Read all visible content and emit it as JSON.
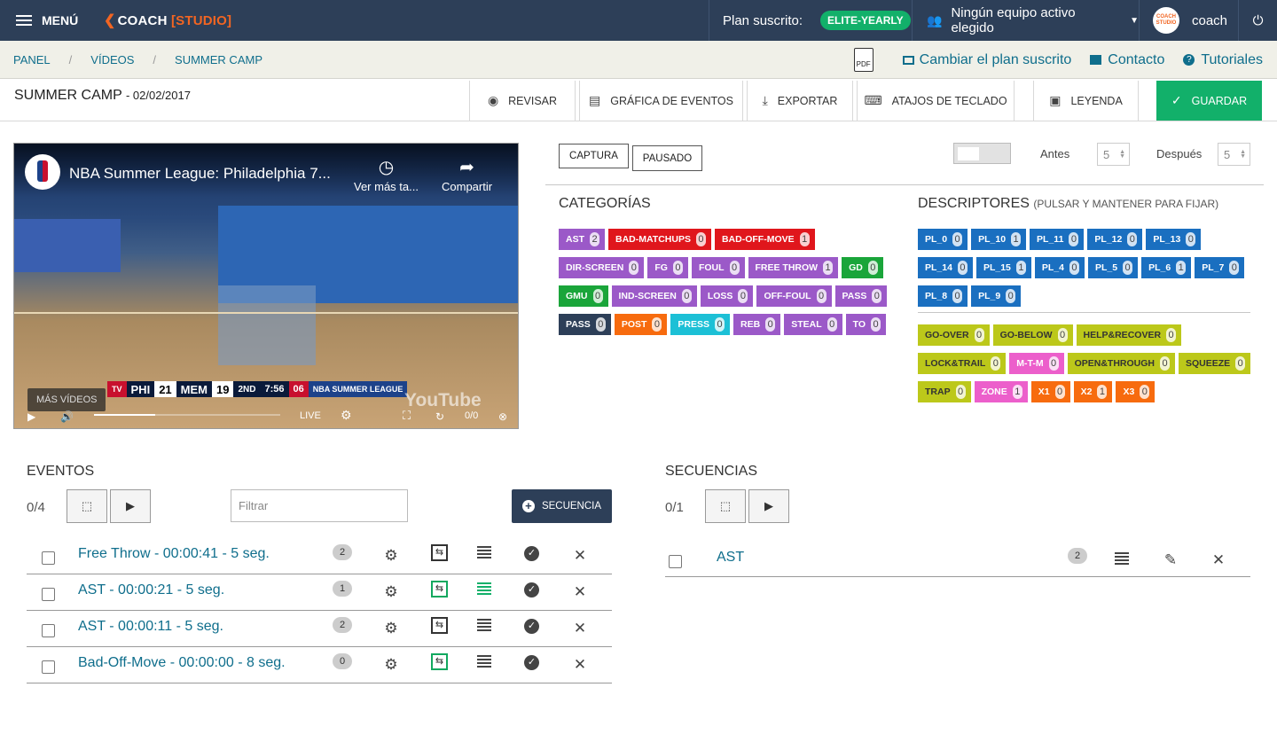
{
  "topbar": {
    "menu_label": "MENÚ",
    "logo_main": "COACH",
    "logo_bracket": "[STUDIO]",
    "plan_label": "Plan suscrito:",
    "plan_badge": "ELITE-YEARLY",
    "team_label": "Ningún equipo activo elegido",
    "avatar_text": "COACH STUDIO",
    "user_name": "coach"
  },
  "breadcrumb": {
    "items": [
      "PANEL",
      "VÍDEOS",
      "SUMMER CAMP"
    ],
    "pdf_label": "PDF",
    "change_plan": "Cambiar el plan suscrito",
    "contact": "Contacto",
    "tutorials": "Tutoriales"
  },
  "title": {
    "name": "SUMMER CAMP",
    "date": "- 02/02/2017"
  },
  "toolbar": {
    "review": "REVISAR",
    "event_chart": "GRÁFICA DE EVENTOS",
    "export": "EXPORTAR",
    "shortcuts": "ATAJOS DE TECLADO",
    "legend": "LEYENDA",
    "save": "GUARDAR"
  },
  "video": {
    "title": "NBA Summer League: Philadelphia 7...",
    "watch_later": "Ver más ta...",
    "share": "Compartir",
    "more_videos": "MÁS VÍDEOS",
    "team1": "PHI",
    "score1": "21",
    "team2": "MEM",
    "score2": "19",
    "quarter": "2ND",
    "clock": "7:56",
    "shot": "06",
    "league": "NBA SUMMER LEAGUE",
    "live": "LIVE",
    "counter": "0/0",
    "yt": "YouTube",
    "progress": 0.33
  },
  "capture": {
    "capture_btn": "CAPTURA",
    "paused_btn": "PAUSADO",
    "before_label": "Antes",
    "before_value": "5",
    "after_label": "Después",
    "after_value": "5"
  },
  "categories": {
    "title": "CATEGORÍAS",
    "items": [
      {
        "label": "AST",
        "count": "2",
        "color": "#9b59c8"
      },
      {
        "label": "BAD-MATCHUPS",
        "count": "0",
        "color": "#e0161c"
      },
      {
        "label": "BAD-OFF-MOVE",
        "count": "1",
        "color": "#e0161c"
      },
      {
        "label": "DIR-SCREEN",
        "count": "0",
        "color": "#9b59c8"
      },
      {
        "label": "FG",
        "count": "0",
        "color": "#9b59c8"
      },
      {
        "label": "FOUL",
        "count": "0",
        "color": "#9b59c8"
      },
      {
        "label": "FREE THROW",
        "count": "1",
        "color": "#9b59c8"
      },
      {
        "label": "GD",
        "count": "0",
        "color": "#1aa53a"
      },
      {
        "label": "GMU",
        "count": "0",
        "color": "#1aa53a"
      },
      {
        "label": "IND-SCREEN",
        "count": "0",
        "color": "#9b59c8"
      },
      {
        "label": "LOSS",
        "count": "0",
        "color": "#9b59c8"
      },
      {
        "label": "OFF-FOUL",
        "count": "0",
        "color": "#9b59c8"
      },
      {
        "label": "PASS",
        "count": "0",
        "color": "#9b59c8"
      },
      {
        "label": "PASS",
        "count": "0",
        "color": "#2d3f58"
      },
      {
        "label": "POST",
        "count": "0",
        "color": "#f76b0e"
      },
      {
        "label": "PRESS",
        "count": "0",
        "color": "#1cc0d6"
      },
      {
        "label": "REB",
        "count": "0",
        "color": "#9b59c8"
      },
      {
        "label": "STEAL",
        "count": "0",
        "color": "#9b59c8"
      },
      {
        "label": "TO",
        "count": "0",
        "color": "#9b59c8"
      }
    ]
  },
  "descriptors": {
    "title": "DESCRIPTORES",
    "subtitle": "(PULSAR Y MANTENER PARA FIJAR)",
    "players": [
      {
        "label": "PL_0",
        "count": "0"
      },
      {
        "label": "PL_10",
        "count": "1"
      },
      {
        "label": "PL_11",
        "count": "0"
      },
      {
        "label": "PL_12",
        "count": "0"
      },
      {
        "label": "PL_13",
        "count": "0"
      },
      {
        "label": "PL_14",
        "count": "0"
      },
      {
        "label": "PL_15",
        "count": "1"
      },
      {
        "label": "PL_4",
        "count": "0"
      },
      {
        "label": "PL_5",
        "count": "0"
      },
      {
        "label": "PL_6",
        "count": "1"
      },
      {
        "label": "PL_7",
        "count": "0"
      },
      {
        "label": "PL_8",
        "count": "0"
      },
      {
        "label": "PL_9",
        "count": "0"
      }
    ],
    "player_color": "#1a6fc0",
    "others": [
      {
        "label": "GO-OVER",
        "count": "0",
        "color": "#bcc81a"
      },
      {
        "label": "GO-BELOW",
        "count": "0",
        "color": "#bcc81a"
      },
      {
        "label": "HELP&RECOVER",
        "count": "0",
        "color": "#bcc81a"
      },
      {
        "label": "LOCK&TRAIL",
        "count": "0",
        "color": "#bcc81a"
      },
      {
        "label": "M-T-M",
        "count": "0",
        "color": "#ec5fcb"
      },
      {
        "label": "OPEN&THROUGH",
        "count": "0",
        "color": "#bcc81a"
      },
      {
        "label": "SQUEEZE",
        "count": "0",
        "color": "#bcc81a"
      },
      {
        "label": "TRAP",
        "count": "0",
        "color": "#bcc81a"
      },
      {
        "label": "ZONE",
        "count": "1",
        "color": "#ec5fcb"
      },
      {
        "label": "X1",
        "count": "0",
        "color": "#f76b0e"
      },
      {
        "label": "X2",
        "count": "1",
        "color": "#f76b0e"
      },
      {
        "label": "X3",
        "count": "0",
        "color": "#f76b0e"
      }
    ]
  },
  "events": {
    "title": "EVENTOS",
    "count": "0/4",
    "filter_placeholder": "Filtrar",
    "sequence_btn": "SECUENCIA",
    "rows": [
      {
        "label": "Free Throw - 00:00:41 - 5 seg.",
        "count": "2",
        "highlight": false
      },
      {
        "label": "AST - 00:00:21 - 5 seg.",
        "count": "1",
        "highlight": true
      },
      {
        "label": "AST - 00:00:11 - 5 seg.",
        "count": "2",
        "highlight": false
      },
      {
        "label": "Bad-Off-Move - 00:00:00 - 8 seg.",
        "count": "0",
        "highlight": "frame"
      }
    ]
  },
  "sequences": {
    "title": "SECUENCIAS",
    "count": "0/1",
    "rows": [
      {
        "label": "AST",
        "count": "2"
      }
    ]
  }
}
